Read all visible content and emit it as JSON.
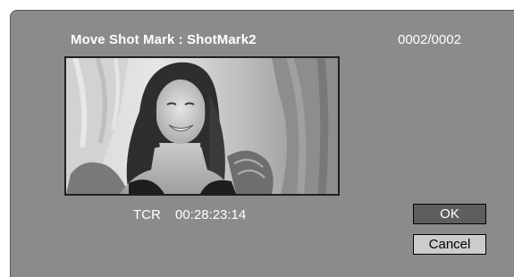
{
  "dialog": {
    "title": "Move Shot Mark : ShotMark2",
    "counter": "0002/0002",
    "preview": {
      "description_icon": "thumbnail-image"
    },
    "timecode": {
      "label": "TCR",
      "value": "00:28:23:14"
    },
    "buttons": {
      "ok_label": "OK",
      "cancel_label": "Cancel"
    }
  },
  "colors": {
    "background": "#8b8b8b",
    "text": "#ffffff",
    "ok_button_bg": "#5e5e5e",
    "cancel_button_bg": "#cccccc"
  }
}
